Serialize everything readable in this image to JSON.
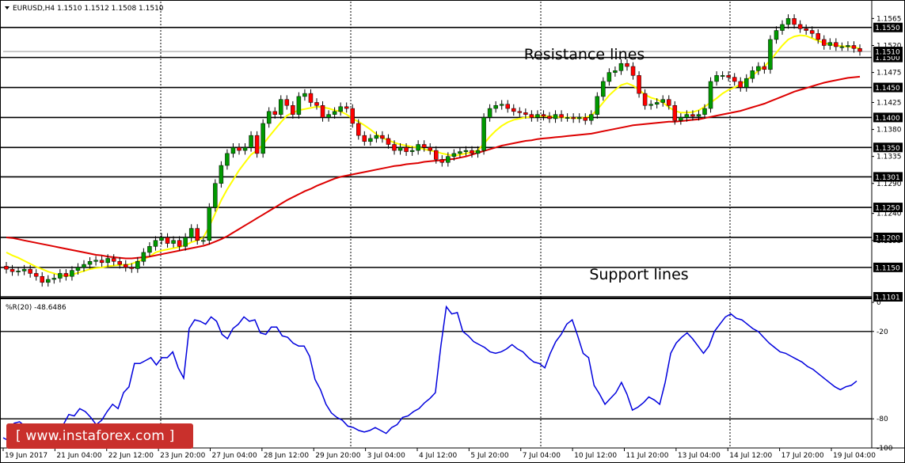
{
  "header": {
    "symbol": "EURUSD,H4",
    "ohlc": "1.1510 1.1512 1.1508 1.1510"
  },
  "annotations": {
    "resistance": "Resistance lines",
    "support": "Support lines"
  },
  "watermark": "[ www.instaforex.com ]",
  "colors": {
    "bull_candle": "#009900",
    "bear_candle": "#ff0000",
    "fast_ma": "#ffff00",
    "slow_ma": "#dd0000",
    "wpr_line": "#0000dd",
    "level_line": "#000000",
    "label_box": "#000000"
  },
  "chart_data": [
    {
      "type": "candlestick",
      "title": "EURUSD,H4",
      "ylim": [
        1.1101,
        1.158
      ],
      "x_labels": [
        "19 Jun 2017",
        "21 Jun 04:00",
        "22 Jun 12:00",
        "23 Jun 20:00",
        "27 Jun 04:00",
        "28 Jun 12:00",
        "29 Jun 20:00",
        "3 Jul 04:00",
        "4 Jul 12:00",
        "5 Jul 20:00",
        "7 Jul 04:00",
        "10 Jul 12:00",
        "11 Jul 20:00",
        "13 Jul 04:00",
        "14 Jul 12:00",
        "17 Jul 20:00",
        "19 Jul 04:00"
      ],
      "y_ticks": [
        "1.1565",
        "1.1520",
        "1.1475",
        "1.1425",
        "1.1380",
        "1.1335",
        "1.1290",
        "1.1240",
        "1.1195"
      ],
      "horizontal_levels": [
        {
          "value": 1.155,
          "label": "1.1550"
        },
        {
          "value": 1.15,
          "label": "1.1500"
        },
        {
          "value": 1.145,
          "label": "1.1450"
        },
        {
          "value": 1.14,
          "label": "1.1400"
        },
        {
          "value": 1.135,
          "label": "1.1350"
        },
        {
          "value": 1.1301,
          "label": "1.1301"
        },
        {
          "value": 1.125,
          "label": "1.1250"
        },
        {
          "value": 1.12,
          "label": "1.1200"
        },
        {
          "value": 1.115,
          "label": "1.1150"
        },
        {
          "value": 1.1101,
          "label": "1.1101"
        }
      ],
      "current_price_label": "1.1510",
      "current_price": 1.151,
      "close": [
        1.1147,
        1.1143,
        1.1144,
        1.1147,
        1.114,
        1.1135,
        1.1125,
        1.113,
        1.1132,
        1.114,
        1.1135,
        1.1145,
        1.115,
        1.1155,
        1.116,
        1.1162,
        1.1158,
        1.1165,
        1.116,
        1.1155,
        1.115,
        1.1148,
        1.116,
        1.1175,
        1.1185,
        1.1195,
        1.12,
        1.119,
        1.1195,
        1.1185,
        1.12,
        1.1215,
        1.1195,
        1.1195,
        1.125,
        1.129,
        1.132,
        1.134,
        1.135,
        1.1345,
        1.135,
        1.137,
        1.134,
        1.139,
        1.141,
        1.1405,
        1.143,
        1.142,
        1.1405,
        1.1435,
        1.144,
        1.1425,
        1.142,
        1.14,
        1.1405,
        1.141,
        1.1418,
        1.1415,
        1.139,
        1.137,
        1.136,
        1.1365,
        1.137,
        1.1365,
        1.1355,
        1.1345,
        1.135,
        1.1343,
        1.1345,
        1.1355,
        1.135,
        1.1345,
        1.133,
        1.1325,
        1.1335,
        1.134,
        1.1343,
        1.1345,
        1.134,
        1.1345,
        1.14,
        1.1415,
        1.142,
        1.1422,
        1.1415,
        1.141,
        1.1408,
        1.1405,
        1.14,
        1.1405,
        1.1402,
        1.1398,
        1.1405,
        1.14,
        1.14,
        1.1398,
        1.14,
        1.1395,
        1.1405,
        1.1435,
        1.146,
        1.1475,
        1.1478,
        1.149,
        1.1485,
        1.147,
        1.144,
        1.142,
        1.1422,
        1.1425,
        1.143,
        1.142,
        1.1395,
        1.14,
        1.1405,
        1.1402,
        1.1405,
        1.1415,
        1.146,
        1.147,
        1.147,
        1.1467,
        1.146,
        1.145,
        1.1465,
        1.1478,
        1.1485,
        1.148,
        1.153,
        1.1545,
        1.1555,
        1.1565,
        1.1555,
        1.1548,
        1.1545,
        1.154,
        1.153,
        1.152,
        1.1525,
        1.1518,
        1.1518,
        1.152,
        1.1515,
        1.151
      ],
      "series": [
        {
          "name": "MA fast",
          "values": [
            1.1175,
            1.117,
            1.1166,
            1.1161,
            1.1156,
            1.1151,
            1.1147,
            1.1143,
            1.114,
            1.1137,
            1.1135,
            1.1138,
            1.1141,
            1.1144,
            1.1147,
            1.1149,
            1.115,
            1.1152,
            1.1153,
            1.1154,
            1.1154,
            1.1156,
            1.116,
            1.1164,
            1.1168,
            1.1175,
            1.1178,
            1.118,
            1.1182,
            1.1184,
            1.1187,
            1.1192,
            1.1195,
            1.12,
            1.1218,
            1.124,
            1.1262,
            1.128,
            1.1296,
            1.1312,
            1.1325,
            1.1338,
            1.1345,
            1.1355,
            1.1368,
            1.138,
            1.1392,
            1.1403,
            1.1408,
            1.1412,
            1.1414,
            1.1416,
            1.1418,
            1.1417,
            1.1415,
            1.1412,
            1.141,
            1.1405,
            1.1398,
            1.1393,
            1.1387,
            1.138,
            1.1372,
            1.1366,
            1.1362,
            1.1358,
            1.1355,
            1.1353,
            1.1351,
            1.135,
            1.1347,
            1.1345,
            1.1343,
            1.134,
            1.1338,
            1.1336,
            1.1338,
            1.134,
            1.1342,
            1.1345,
            1.1356,
            1.1368,
            1.1378,
            1.1386,
            1.1392,
            1.1396,
            1.1398,
            1.14,
            1.1401,
            1.1402,
            1.1402,
            1.1402,
            1.1401,
            1.14,
            1.14,
            1.1399,
            1.1399,
            1.14,
            1.1403,
            1.1413,
            1.1425,
            1.1437,
            1.1446,
            1.1454,
            1.1457,
            1.1453,
            1.1446,
            1.1438,
            1.1433,
            1.143,
            1.1425,
            1.1417,
            1.1411,
            1.1408,
            1.1408,
            1.1409,
            1.1412,
            1.1418,
            1.1425,
            1.1432,
            1.144,
            1.1446,
            1.145,
            1.1455,
            1.1462,
            1.147,
            1.1478,
            1.1485,
            1.1495,
            1.1508,
            1.152,
            1.153,
            1.1535,
            1.1537,
            1.1536,
            1.1532,
            1.1528,
            1.1524,
            1.1522,
            1.152,
            1.1519,
            1.1518,
            1.1517,
            1.1515
          ]
        },
        {
          "name": "MA slow",
          "values": [
            1.12,
            1.1199,
            1.1197,
            1.1195,
            1.1193,
            1.1191,
            1.1189,
            1.1187,
            1.1185,
            1.1183,
            1.1181,
            1.1179,
            1.1177,
            1.1175,
            1.1173,
            1.1171,
            1.117,
            1.1168,
            1.1167,
            1.1166,
            1.1165,
            1.1165,
            1.1166,
            1.1167,
            1.1168,
            1.117,
            1.1172,
            1.1174,
            1.1176,
            1.1178,
            1.118,
            1.1182,
            1.1184,
            1.1186,
            1.1189,
            1.1193,
            1.1197,
            1.1202,
            1.1208,
            1.1214,
            1.122,
            1.1226,
            1.1232,
            1.1238,
            1.1244,
            1.125,
            1.1256,
            1.1262,
            1.1267,
            1.1272,
            1.1277,
            1.1281,
            1.1286,
            1.129,
            1.1294,
            1.1298,
            1.1301,
            1.1303,
            1.1305,
            1.1307,
            1.1309,
            1.1311,
            1.1313,
            1.1315,
            1.1317,
            1.1319,
            1.132,
            1.1322,
            1.1323,
            1.1324,
            1.1326,
            1.1327,
            1.1328,
            1.1329,
            1.133,
            1.1331,
            1.1333,
            1.1335,
            1.1338,
            1.1341,
            1.1344,
            1.1347,
            1.135,
            1.1353,
            1.1355,
            1.1357,
            1.1359,
            1.1361,
            1.1362,
            1.1364,
            1.1365,
            1.1366,
            1.1367,
            1.1368,
            1.1369,
            1.137,
            1.1371,
            1.1372,
            1.1373,
            1.1375,
            1.1377,
            1.1379,
            1.1381,
            1.1383,
            1.1385,
            1.1387,
            1.1388,
            1.1389,
            1.139,
            1.1391,
            1.1392,
            1.1393,
            1.1393,
            1.1394,
            1.1395,
            1.1396,
            1.1397,
            1.1399,
            1.1401,
            1.1403,
            1.1405,
            1.1407,
            1.1409,
            1.1411,
            1.1414,
            1.1417,
            1.142,
            1.1423,
            1.1427,
            1.1431,
            1.1435,
            1.1439,
            1.1443,
            1.1446,
            1.1449,
            1.1452,
            1.1455,
            1.1458,
            1.146,
            1.1462,
            1.1464,
            1.1466,
            1.1467,
            1.1468
          ]
        }
      ]
    },
    {
      "type": "line",
      "title": "%R(20) -48.6486",
      "ylim": [
        -100,
        0
      ],
      "y_ticks": [
        "0",
        "-20",
        "-80",
        "-100"
      ],
      "levels": [
        -20,
        -80
      ],
      "series": [
        {
          "values": [
            -93,
            -95,
            -83,
            -82,
            -85,
            -95,
            -94,
            -90,
            -92,
            -88,
            -85,
            -84,
            -77,
            -78,
            -73,
            -75,
            -79,
            -84,
            -81,
            -75,
            -70,
            -73,
            -62,
            -58,
            -42,
            -42,
            -40,
            -38,
            -43,
            -38,
            -38,
            -34,
            -45,
            -52,
            -18,
            -12,
            -13,
            -15,
            -10,
            -13,
            -22,
            -25,
            -18,
            -15,
            -10,
            -13,
            -12,
            -21,
            -22,
            -17,
            -17,
            -23,
            -24,
            -28,
            -30,
            -30,
            -37,
            -53,
            -60,
            -70,
            -76,
            -79,
            -81,
            -85,
            -86,
            -88,
            -89,
            -88,
            -86,
            -88,
            -90,
            -86,
            -84,
            -79,
            -78,
            -75,
            -73,
            -69,
            -66,
            -62,
            -30,
            -3,
            -8,
            -7,
            -20,
            -23,
            -27,
            -29,
            -31,
            -34,
            -35,
            -34,
            -32,
            -29,
            -32,
            -34,
            -38,
            -41,
            -42,
            -45,
            -35,
            -27,
            -22,
            -15,
            -12,
            -23,
            -35,
            -38,
            -57,
            -63,
            -70,
            -66,
            -62,
            -55,
            -63,
            -74,
            -72,
            -69,
            -65,
            -67,
            -70,
            -55,
            -35,
            -28,
            -24,
            -21,
            -25,
            -30,
            -35,
            -30,
            -20,
            -15,
            -10,
            -8,
            -11,
            -12,
            -15,
            -18,
            -20,
            -24,
            -28,
            -31,
            -34,
            -35,
            -37,
            -39,
            -41,
            -44,
            -46,
            -49,
            -52,
            -55,
            -58,
            -60,
            -58,
            -57,
            -54
          ]
        }
      ]
    }
  ]
}
